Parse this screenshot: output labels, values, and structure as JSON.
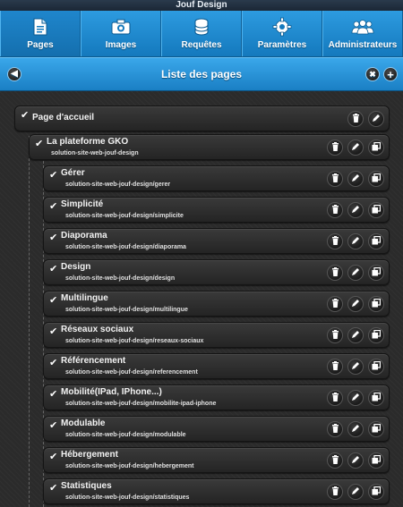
{
  "app": {
    "title": "Jouf Design"
  },
  "nav": {
    "items": [
      {
        "label": "Pages",
        "icon": "document-icon"
      },
      {
        "label": "Images",
        "icon": "camera-icon"
      },
      {
        "label": "Requêtes",
        "icon": "database-icon"
      },
      {
        "label": "Paramètres",
        "icon": "gear-icon"
      },
      {
        "label": "Administrateurs",
        "icon": "users-icon"
      }
    ],
    "more_label": "+"
  },
  "header": {
    "title": "Liste des pages",
    "back_icon": "arrow-left-icon",
    "collapse_icon": "collapse-icon",
    "add_icon": "plus-icon"
  },
  "pages": {
    "root": {
      "title": "Page d'accueil"
    },
    "child": {
      "title": "La plateforme GKO",
      "slug": "solution-site-web-jouf-design"
    },
    "subpages": [
      {
        "title": "Gérer",
        "slug": "solution-site-web-jouf-design/gerer"
      },
      {
        "title": "Simplicité",
        "slug": "solution-site-web-jouf-design/simplicite"
      },
      {
        "title": "Diaporama",
        "slug": "solution-site-web-jouf-design/diaporama"
      },
      {
        "title": "Design",
        "slug": "solution-site-web-jouf-design/design"
      },
      {
        "title": "Multilingue",
        "slug": "solution-site-web-jouf-design/multilingue"
      },
      {
        "title": "Réseaux sociaux",
        "slug": "solution-site-web-jouf-design/reseaux-sociaux"
      },
      {
        "title": "Référencement",
        "slug": "solution-site-web-jouf-design/referencement"
      },
      {
        "title": "Mobilité(IPad, IPhone...)",
        "slug": "solution-site-web-jouf-design/mobilite-ipad-iphone"
      },
      {
        "title": "Modulable",
        "slug": "solution-site-web-jouf-design/modulable"
      },
      {
        "title": "Hébergement",
        "slug": "solution-site-web-jouf-design/hebergement"
      },
      {
        "title": "Statistiques",
        "slug": "solution-site-web-jouf-design/statistiques"
      }
    ]
  },
  "colors": {
    "nav_blue": "#1d8ad3",
    "row_bg": "#2f2f2f",
    "page_bg": "#2b2b2b"
  }
}
